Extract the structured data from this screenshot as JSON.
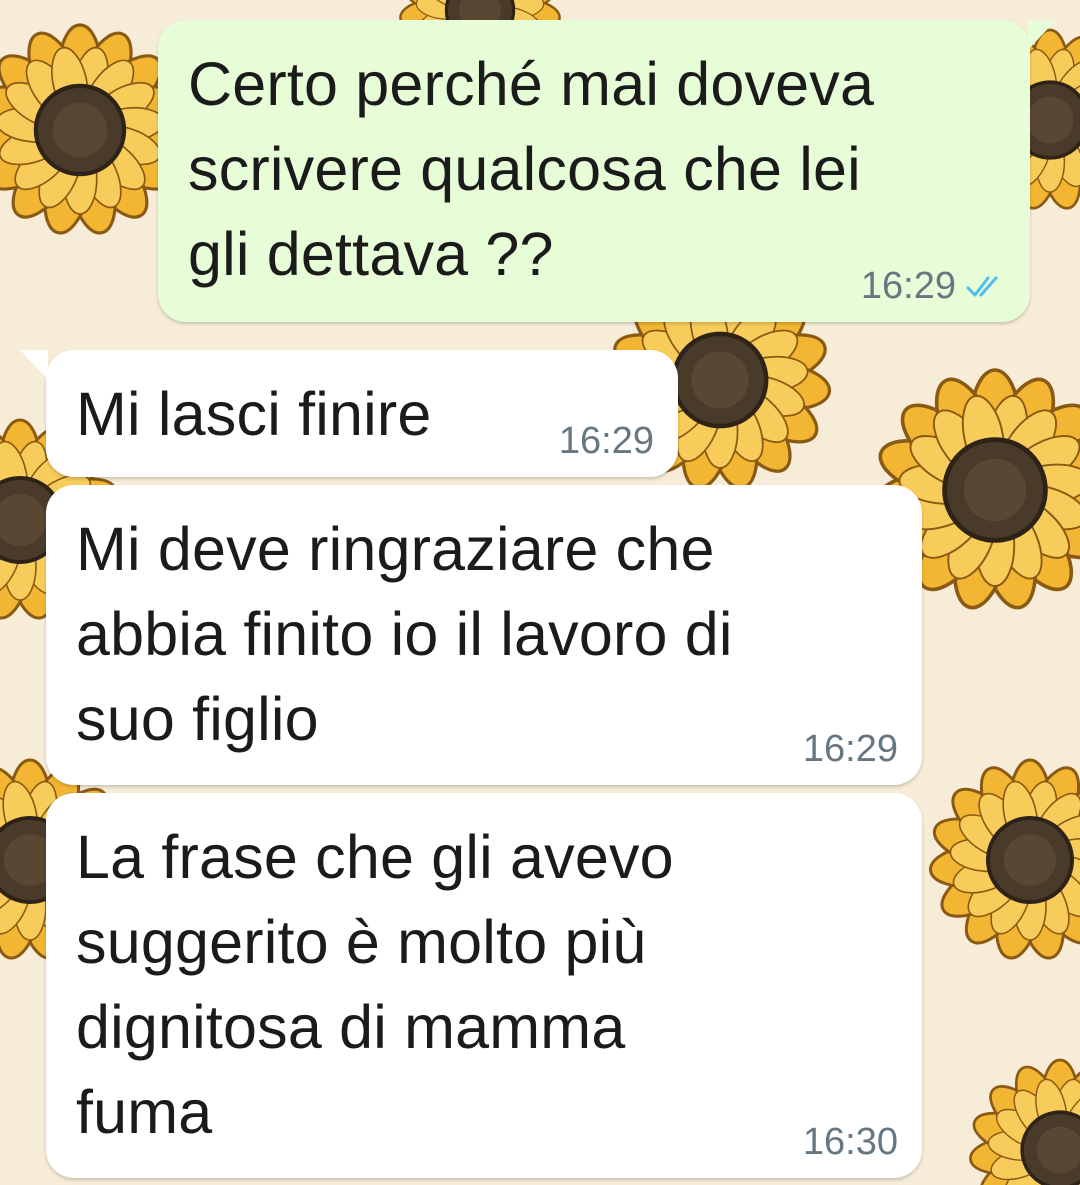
{
  "conversation": {
    "messages": [
      {
        "direction": "outgoing",
        "text": "Certo perché mai doveva\nscrivere qualcosa che lei\ngli dettava ??",
        "time": "16:29",
        "status": "read",
        "status_icon": "double-check-icon",
        "status_color": "#53bdeb"
      },
      {
        "direction": "incoming",
        "text": "Mi lasci finire",
        "time": "16:29"
      },
      {
        "direction": "incoming",
        "text": "Mi deve ringraziare che\nabbia finito io il lavoro di\nsuo figlio",
        "time": "16:29"
      },
      {
        "direction": "incoming",
        "text": "La frase che gli avevo\nsuggerito è molto più\ndignitosa di mamma\nfuma",
        "time": "16:30"
      }
    ]
  },
  "colors": {
    "outgoing_bubble": "#e7fdd7",
    "incoming_bubble": "#ffffff",
    "wallpaper_background": "#f6ecd7",
    "sunflower_petal": "#f2b632",
    "sunflower_center": "#4a3a2a"
  }
}
